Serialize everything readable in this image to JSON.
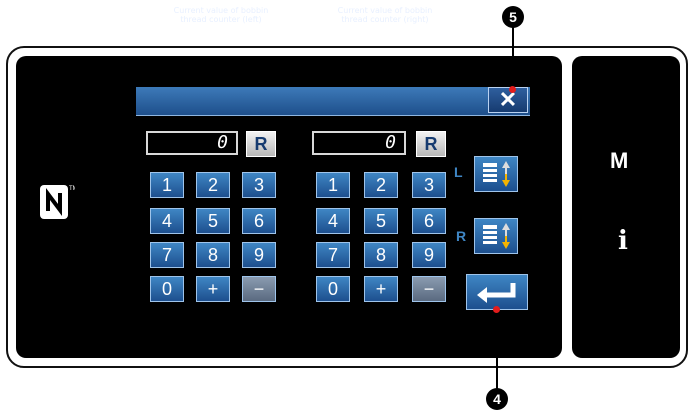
{
  "header": {
    "left_title": "Current value of bobbin thread counter (left)",
    "right_title": "Current value of bobbin thread counter (right)",
    "close_label": "✕"
  },
  "left_counter": {
    "value": "0",
    "reset_label": "R",
    "keys": [
      "1",
      "2",
      "3",
      "4",
      "5",
      "6",
      "7",
      "8",
      "9",
      "0",
      "+",
      "−"
    ]
  },
  "right_counter": {
    "value": "0",
    "reset_label": "R",
    "keys": [
      "1",
      "2",
      "3",
      "4",
      "5",
      "6",
      "7",
      "8",
      "9",
      "0",
      "+",
      "−"
    ]
  },
  "side": {
    "l_label": "L",
    "r_label": "R"
  },
  "right_panel": {
    "m_label": "M",
    "i_label": "i"
  },
  "callouts": {
    "close": "5",
    "enter": "4"
  },
  "colors": {
    "key_blue": "#2a67a8",
    "highlight_red": "#e31c1c"
  },
  "icons": [
    "nfc-icon",
    "close-icon",
    "bobbin-winder-icon",
    "enter-icon"
  ]
}
